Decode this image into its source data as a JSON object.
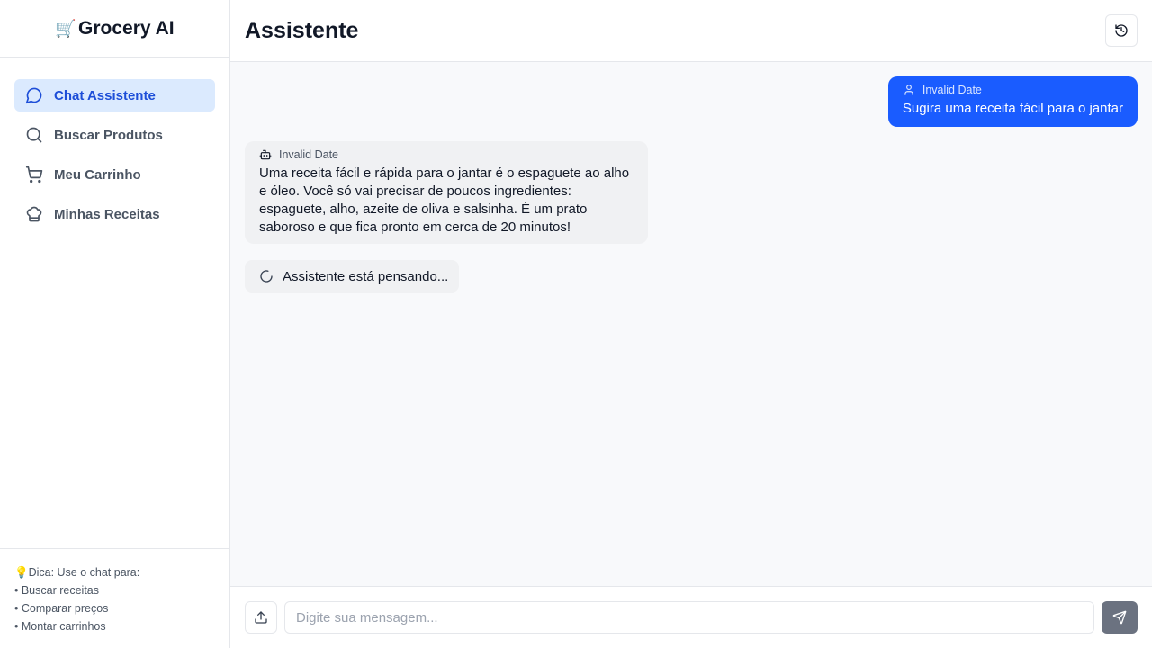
{
  "app": {
    "brand_emoji": "🛒",
    "brand_name": "Grocery AI"
  },
  "sidebar": {
    "items": [
      {
        "label": "Chat Assistente",
        "icon": "message-circle-icon",
        "active": true
      },
      {
        "label": "Buscar Produtos",
        "icon": "search-icon",
        "active": false
      },
      {
        "label": "Meu Carrinho",
        "icon": "shopping-cart-icon",
        "active": false
      },
      {
        "label": "Minhas Receitas",
        "icon": "chef-hat-icon",
        "active": false
      }
    ],
    "tip": {
      "title": "💡Dica: Use o chat para:",
      "lines": [
        "• Buscar receitas",
        "• Comparar preços",
        "• Montar carrinhos"
      ]
    }
  },
  "header": {
    "title": "Assistente",
    "history_icon": "history-icon"
  },
  "chat": {
    "messages": [
      {
        "role": "user",
        "timestamp": "Invalid Date",
        "text": "Sugira uma receita fácil para o jantar",
        "icon": "user-icon"
      },
      {
        "role": "assistant",
        "timestamp": "Invalid Date",
        "text": "Uma receita fácil e rápida para o jantar é o espaguete ao alho e óleo. Você só vai precisar de poucos ingredientes: espaguete, alho, azeite de oliva e salsinha. É um prato saboroso e que fica pronto em cerca de 20 minutos!",
        "icon": "bot-icon"
      }
    ],
    "thinking": "Assistente está pensando..."
  },
  "composer": {
    "placeholder": "Digite sua mensagem...",
    "value": ""
  },
  "colors": {
    "accent": "#1a5cff",
    "active_nav_bg": "#dbeafe",
    "active_nav_text": "#1d4ed8"
  }
}
